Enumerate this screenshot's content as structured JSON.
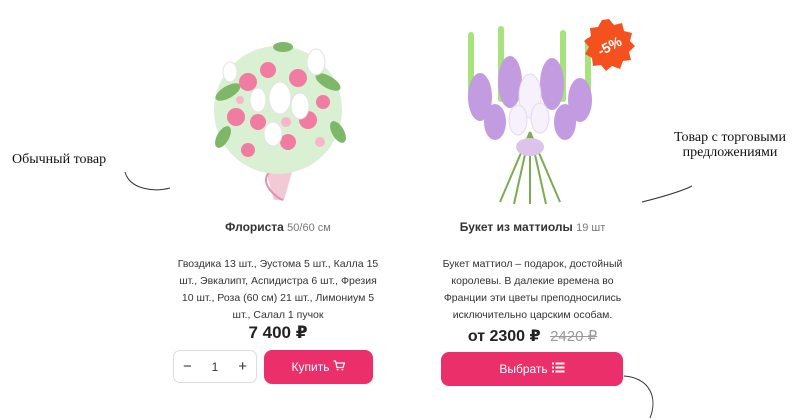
{
  "annotations": {
    "regular_product": "Обычный товар",
    "offers_product": "Товар с торговыми предложениями"
  },
  "products": [
    {
      "name": "Флориста",
      "meta": "50/60 см",
      "description": "Гвоздика 13 шт., Эустома 5 шт., Калла 15 шт., Эвкалипт, Аспидистра 6 шт., Фрезия 10 шт., Роза (60 см) 21 шт., Лимониум 5 шт., Салал 1 пучок",
      "price": "7 400 ₽",
      "quantity": "1",
      "minus": "−",
      "plus": "+",
      "button": "Купить",
      "button_icon": "cart-icon",
      "image": "pink-white-bouquet"
    },
    {
      "name": "Букет из маттиолы",
      "meta": "19 шт",
      "description": "Букет маттиол – подарок, достойный королевы. В далекие времена во Франции эти цветы преподносились исключительно царским особам.",
      "price": "от 2300 ₽",
      "old_price": "2420 ₽",
      "badge": "-5%",
      "button": "Выбрать",
      "button_icon": "list-icon",
      "image": "matthiola-bouquet"
    }
  ],
  "colors": {
    "accent": "#eb2f6a",
    "badge": "#f4511e"
  }
}
